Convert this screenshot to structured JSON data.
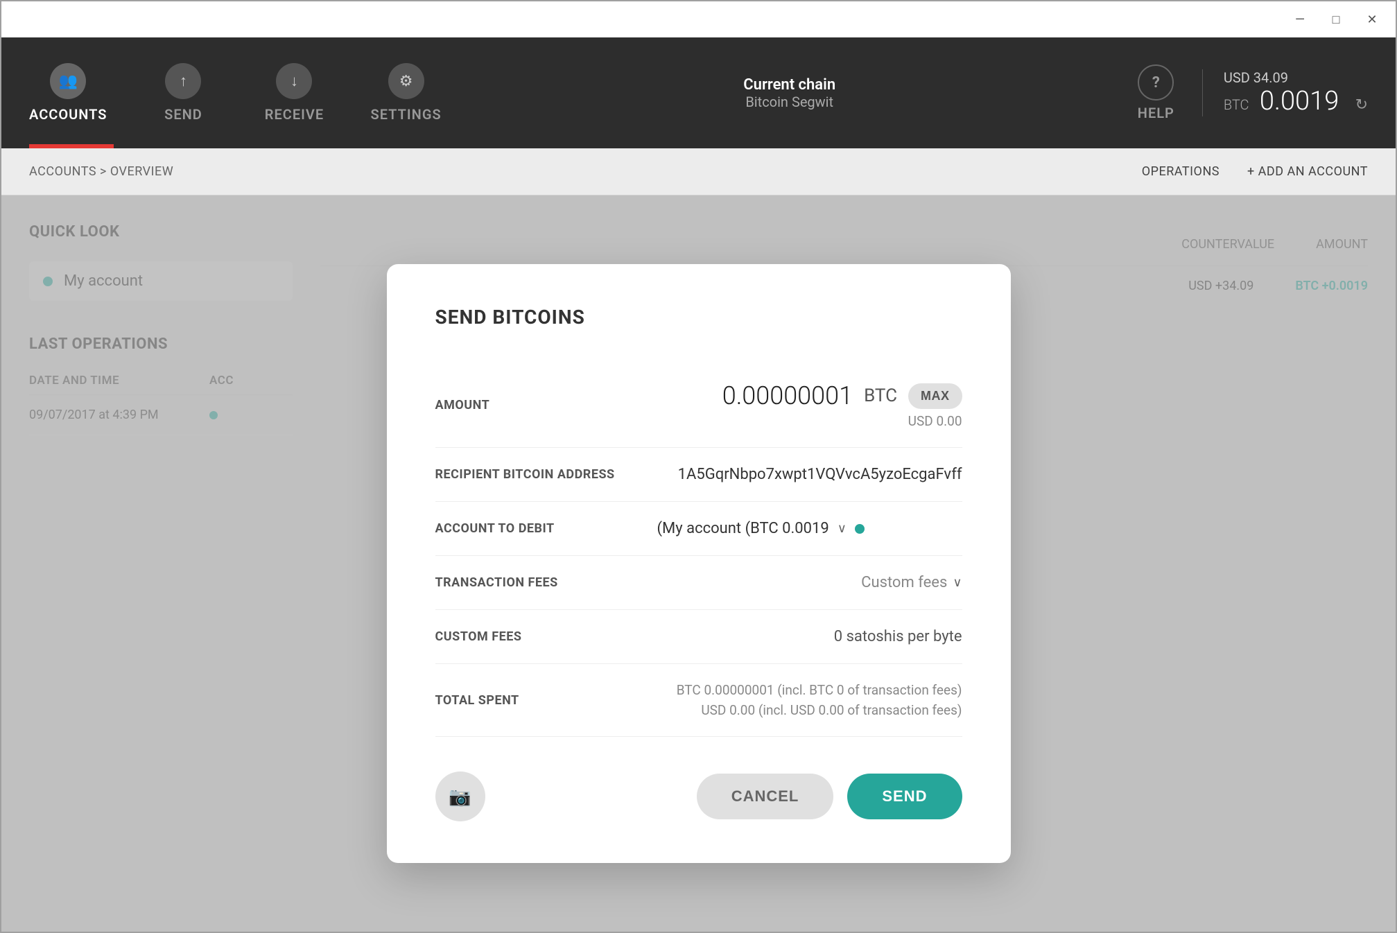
{
  "window": {
    "title": "Bitcoin Wallet"
  },
  "titlebar": {
    "minimize_label": "—",
    "maximize_label": "□",
    "close_label": "✕"
  },
  "topnav": {
    "items": [
      {
        "id": "accounts",
        "label": "ACCOUNTS",
        "icon": "👥",
        "active": true
      },
      {
        "id": "send",
        "label": "SEND",
        "icon": "↑",
        "active": false
      },
      {
        "id": "receive",
        "label": "RECEIVE",
        "icon": "↓",
        "active": false
      },
      {
        "id": "settings",
        "label": "SETTINGS",
        "icon": "⚙",
        "active": false
      }
    ],
    "current_chain_label": "Current chain",
    "current_chain_value": "Bitcoin Segwit",
    "help_label": "HELP",
    "balance_usd": "USD 34.09",
    "balance_btc_prefix": "BTC",
    "balance_btc_value": "0.0019"
  },
  "secondarynav": {
    "breadcrumb": "ACCOUNTS > OVERVIEW",
    "operations_link": "OPERATIONS",
    "add_account_link": "+ ADD AN ACCOUNT"
  },
  "quicklook": {
    "title": "QUICK LOOK",
    "account_name": "My account"
  },
  "lastoperations": {
    "title": "LAST OPERATIONS",
    "columns": {
      "date": "DATE AND TIME",
      "account": "ACC",
      "countervalue": "COUNTERVALUE",
      "amount": "AMOUNT"
    },
    "rows": [
      {
        "date": "09/07/2017 at 4:39 PM",
        "countervalue": "USD +34.09",
        "amount": "BTC +0.0019"
      }
    ]
  },
  "modal": {
    "title": "SEND BITCOINS",
    "amount_label": "AMOUNT",
    "amount_value": "0.00000001",
    "amount_btc": "BTC",
    "amount_max_btn": "MAX",
    "amount_usd": "USD 0.00",
    "recipient_label": "RECIPIENT BITCOIN ADDRESS",
    "recipient_value": "1A5GqrNbpo7xwpt1VQVvcA5yzoEcgaFvff",
    "account_debit_label": "ACCOUNT TO DEBIT",
    "account_debit_value": "(My account (BTC 0.0019",
    "account_debit_chevron": "∨",
    "fees_label": "TRANSACTION FEES",
    "fees_value": "Custom fees",
    "fees_chevron": "∨",
    "custom_fees_label": "CUSTOM FEES",
    "custom_fees_value": "0 satoshis per byte",
    "total_spent_label": "TOTAL SPENT",
    "total_line1": "BTC 0.00000001 (incl. BTC 0 of transaction fees)",
    "total_line2": "USD 0.00 (incl. USD 0.00 of transaction fees)",
    "camera_icon": "📷",
    "cancel_label": "CANCEL",
    "send_label": "SEND"
  }
}
